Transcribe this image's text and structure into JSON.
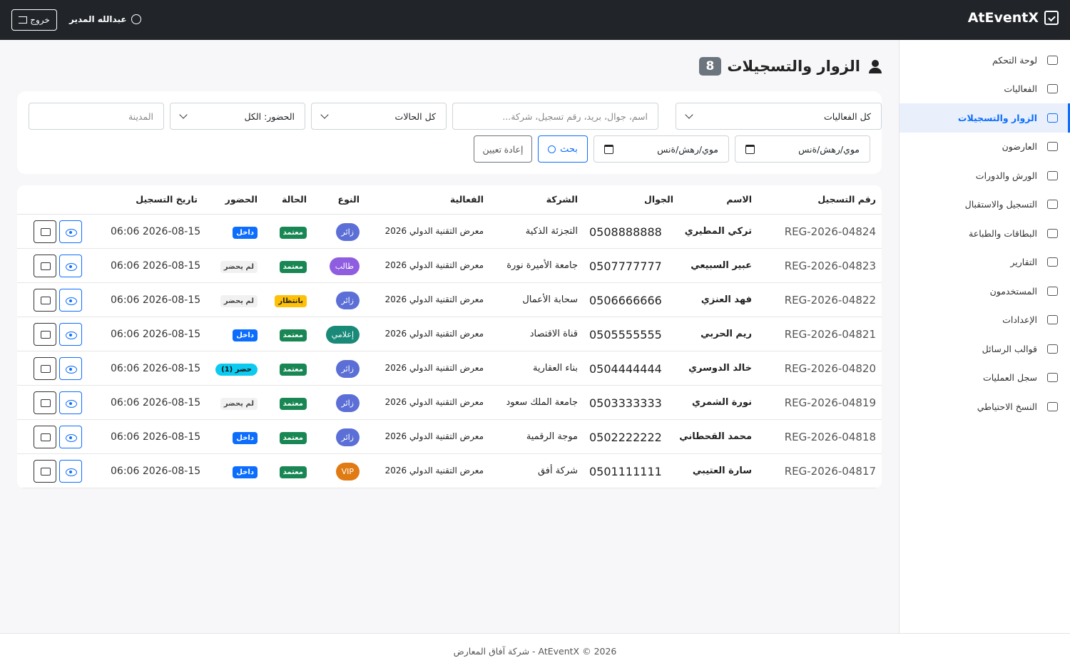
{
  "app": {
    "brand": "AtEventX",
    "user_name": "عبدالله المدير",
    "logout_label": "خروج"
  },
  "sidebar": {
    "items": [
      {
        "label": "لوحة التحكم",
        "icon": "speedometer-icon"
      },
      {
        "label": "الفعاليات",
        "icon": "calendar-icon"
      },
      {
        "label": "الزوار والتسجيلات",
        "icon": "person-lines-icon",
        "active": true
      },
      {
        "label": "العارضون",
        "icon": "shop-icon"
      },
      {
        "label": "الورش والدورات",
        "icon": "easel-icon"
      },
      {
        "label": "التسجيل والاستقبال",
        "icon": "phone-scan-icon"
      },
      {
        "label": "البطاقات والطباعة",
        "icon": "id-card-icon"
      },
      {
        "label": "التقارير",
        "icon": "graph-icon"
      },
      {
        "label": "المستخدمون",
        "icon": "people-icon"
      },
      {
        "label": "الإعدادات",
        "icon": "gear-icon"
      },
      {
        "label": "قوالب الرسائل",
        "icon": "envelope-icon"
      },
      {
        "label": "سجل العمليات",
        "icon": "journal-icon"
      },
      {
        "label": "النسخ الاحتياطي",
        "icon": "database-icon"
      }
    ]
  },
  "page": {
    "title": "الزوار والتسجيلات",
    "count": "8"
  },
  "filters": {
    "event_select": "كل الفعاليات",
    "search_placeholder": "اسم، جوال، بريد، رقم تسجيل، شركة...",
    "status_select": "كل الحالات",
    "attendance_select": "الحضور: الكل",
    "city_placeholder": "المدينة",
    "date_from": "موي/رهش/ةنس",
    "date_to": "موي/رهش/ةنس",
    "search_button": "بحث",
    "reset_button": "إعادة تعيين"
  },
  "table": {
    "headers": {
      "reg": "رقم التسجيل",
      "name": "الاسم",
      "phone": "الجوال",
      "company": "الشركة",
      "event": "الفعالية",
      "type": "النوع",
      "status": "الحالة",
      "attendance": "الحضور",
      "date": "تاريخ التسجيل"
    },
    "rows": [
      {
        "reg": "REG-2026-04824",
        "name": "تركي المطيري",
        "phone": "0508888888",
        "company": "التجزئة الذكية",
        "event": "معرض التقنية الدولي 2026",
        "type": "زائر",
        "status": "معتمد",
        "attendance": "داخل",
        "date": "2026-08-15 06:06"
      },
      {
        "reg": "REG-2026-04823",
        "name": "عبير السبيعي",
        "phone": "0507777777",
        "company": "جامعة الأميرة نورة",
        "event": "معرض التقنية الدولي 2026",
        "type": "طالب",
        "status": "معتمد",
        "attendance": "لم يحضر",
        "date": "2026-08-15 06:06"
      },
      {
        "reg": "REG-2026-04822",
        "name": "فهد العنزي",
        "phone": "0506666666",
        "company": "سحابة الأعمال",
        "event": "معرض التقنية الدولي 2026",
        "type": "زائر",
        "status": "بانتظار",
        "attendance": "لم يحضر",
        "date": "2026-08-15 06:06"
      },
      {
        "reg": "REG-2026-04821",
        "name": "ريم الحربي",
        "phone": "0505555555",
        "company": "قناة الاقتصاد",
        "event": "معرض التقنية الدولي 2026",
        "type": "إعلامي",
        "status": "معتمد",
        "attendance": "داخل",
        "date": "2026-08-15 06:06"
      },
      {
        "reg": "REG-2026-04820",
        "name": "خالد الدوسري",
        "phone": "0504444444",
        "company": "بناء العقارية",
        "event": "معرض التقنية الدولي 2026",
        "type": "زائر",
        "status": "معتمد",
        "attendance": "حضر (1)",
        "date": "2026-08-15 06:06"
      },
      {
        "reg": "REG-2026-04819",
        "name": "نورة الشمري",
        "phone": "0503333333",
        "company": "جامعة الملك سعود",
        "event": "معرض التقنية الدولي 2026",
        "type": "زائر",
        "status": "معتمد",
        "attendance": "لم يحضر",
        "date": "2026-08-15 06:06"
      },
      {
        "reg": "REG-2026-04818",
        "name": "محمد القحطاني",
        "phone": "0502222222",
        "company": "موجة الرقمية",
        "event": "معرض التقنية الدولي 2026",
        "type": "زائر",
        "status": "معتمد",
        "attendance": "داخل",
        "date": "2026-08-15 06:06"
      },
      {
        "reg": "REG-2026-04817",
        "name": "سارة العتيبي",
        "phone": "0501111111",
        "company": "شركة أفق",
        "event": "معرض التقنية الدولي 2026",
        "type": "VIP",
        "status": "معتمد",
        "attendance": "داخل",
        "date": "2026-08-15 06:06"
      }
    ]
  },
  "colors": {
    "primary": "#0d6efd",
    "visitor": "#5b6fd6",
    "student": "#8f5ee0",
    "media": "#1a8a78",
    "vip": "#e07a12",
    "approved": "#198754",
    "pending": "#ffc107",
    "inside": "#0d6efd",
    "attended": "#0dcaf0",
    "absent": "#f1f1f1"
  },
  "footer": {
    "text": "2026 © AtEventX - شركة آفاق المعارض"
  }
}
